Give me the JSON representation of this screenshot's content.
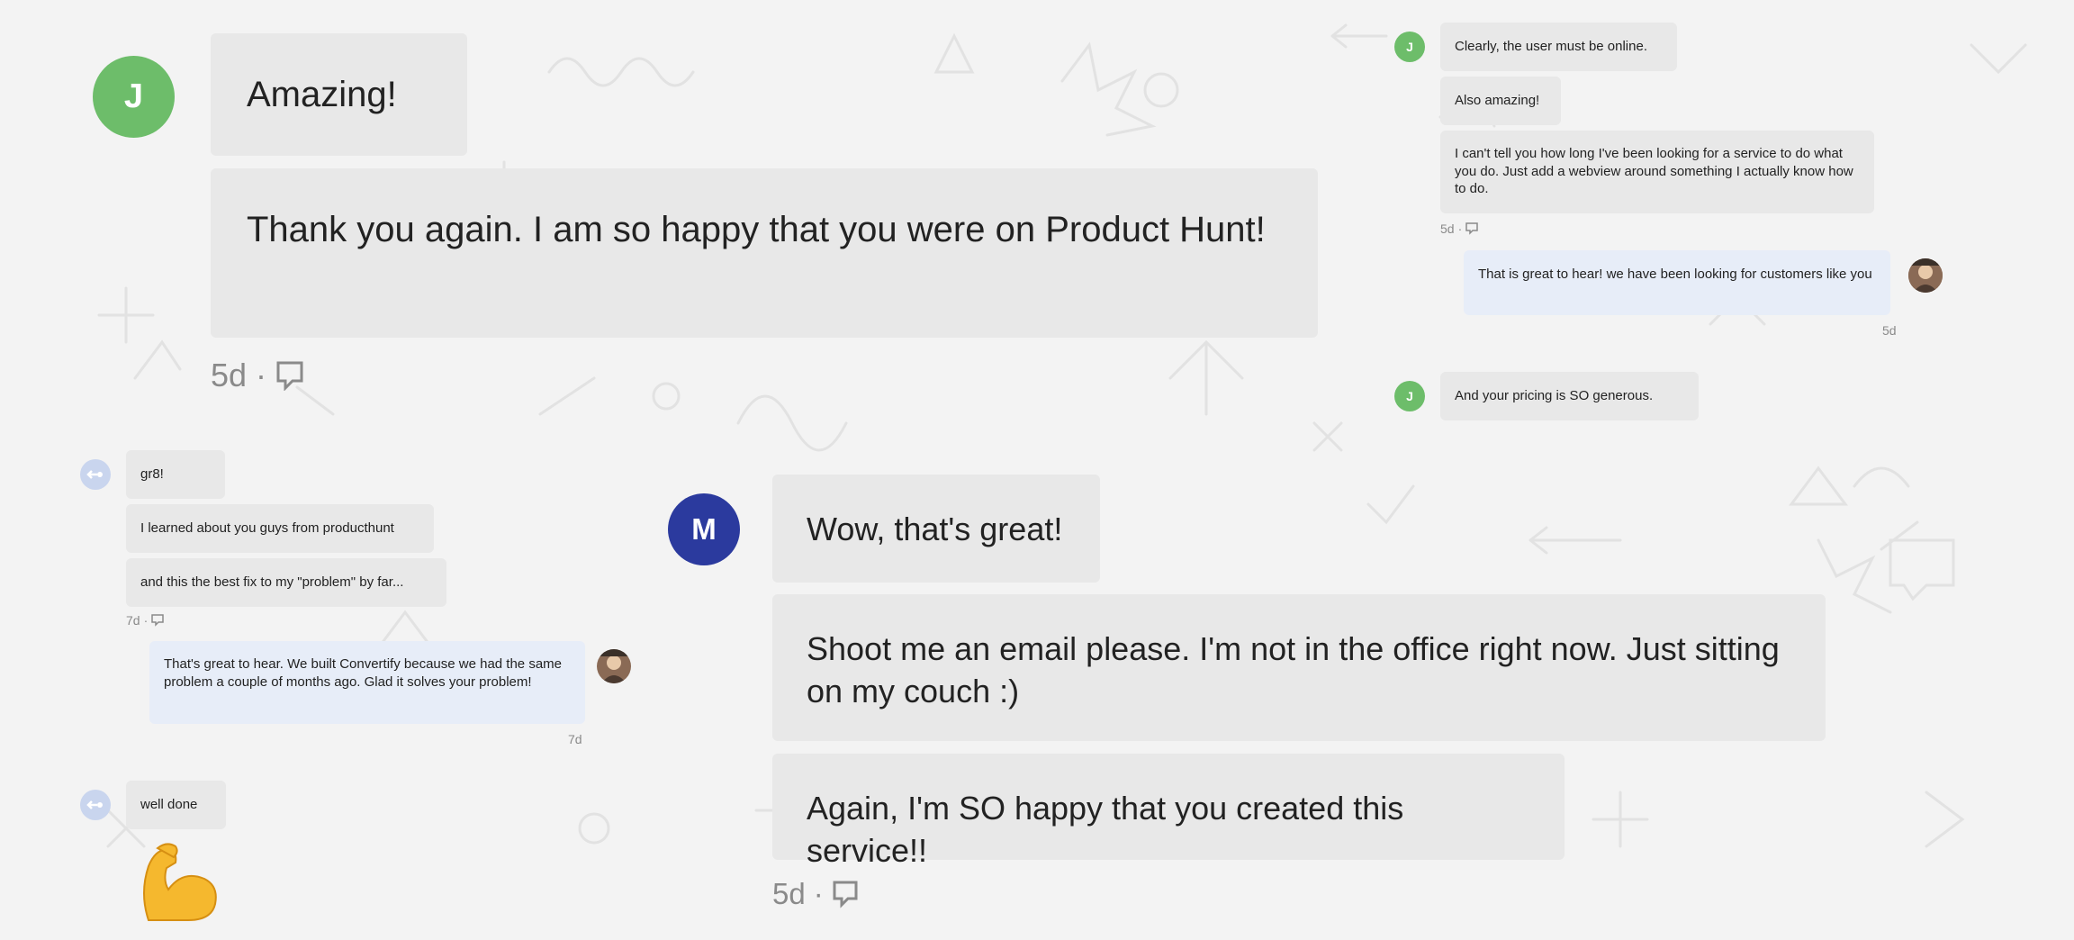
{
  "colors": {
    "bubble_in": "#e8e8e8",
    "bubble_out": "#e7edf8",
    "avatar_j": "#6dbd6a",
    "avatar_m": "#2b3a9e",
    "avatar_anon": "#c9d5ee",
    "meta_text": "#8a8a8a"
  },
  "panel1": {
    "avatar": "J",
    "messages": [
      "Amazing!",
      "Thank you again. I am so happy that you were on Product Hunt!"
    ],
    "time": "5d",
    "sep": "·"
  },
  "panel2": {
    "avatar": "J",
    "messages": [
      "Clearly, the user must be online.",
      "Also amazing!",
      "I can't tell you how long I've been looking for a service to do what you do. Just add a webview around something I actually know how to do."
    ],
    "time": "5d",
    "sep": "·",
    "reply": "That is great to hear! we have been looking for customers like you",
    "reply_time": "5d",
    "avatar2": "J",
    "last": "And your pricing is SO generous."
  },
  "panel3": {
    "messages": [
      "gr8!",
      "I learned about you guys from producthunt",
      "and this the best fix to my \"problem\" by far..."
    ],
    "time": "7d",
    "sep": "·",
    "reply": "That's great to hear. We built Convertify because we had the same problem a couple of months ago. Glad it solves your problem!",
    "reply_time": "7d",
    "last": "well done",
    "emoji": "flexed-biceps"
  },
  "panel4": {
    "avatar": "M",
    "messages": [
      "Wow, that's great!",
      "Shoot me an email please. I'm not in the office right now. Just sitting on my couch :)",
      "Again, I'm SO happy that you created this service!!"
    ],
    "time": "5d",
    "sep": "·"
  }
}
